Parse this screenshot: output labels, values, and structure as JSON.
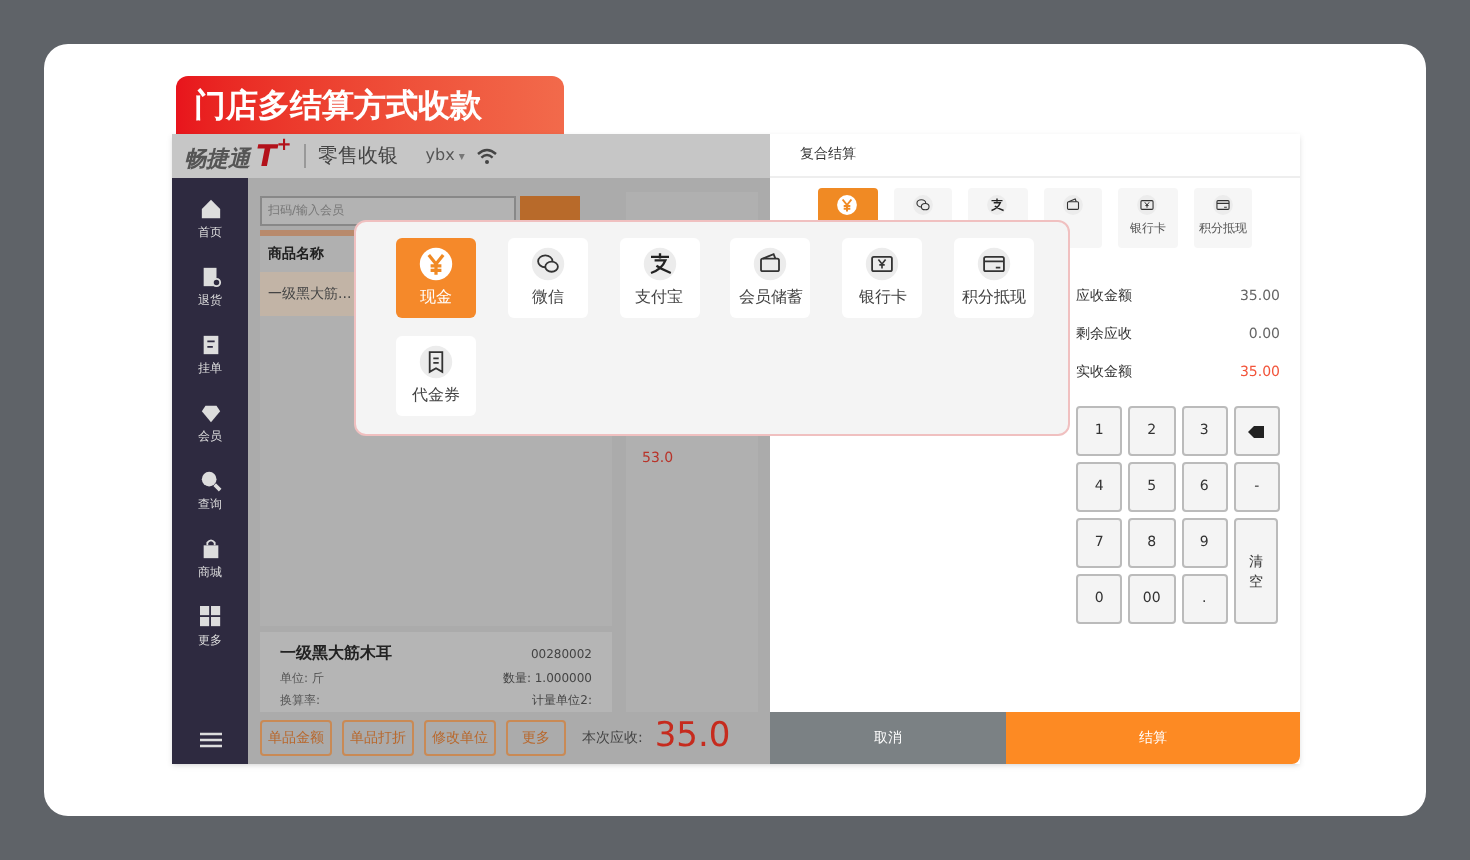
{
  "banner": {
    "title": "门店多结算方式收款"
  },
  "app": {
    "logo": "畅捷通",
    "logo_mark": "T",
    "logo_sup": "+",
    "module": "零售收银",
    "user": "ybx",
    "user_caret": "▾"
  },
  "sidebar": {
    "items": [
      {
        "label": "首页",
        "kind": "home"
      },
      {
        "label": "退货",
        "kind": "return"
      },
      {
        "label": "挂单",
        "kind": "hold"
      },
      {
        "label": "会员",
        "kind": "member"
      },
      {
        "label": "查询",
        "kind": "search"
      },
      {
        "label": "商城",
        "kind": "shop"
      },
      {
        "label": "更多",
        "kind": "more"
      }
    ]
  },
  "search": {
    "placeholder": "扫码/输入会员"
  },
  "table": {
    "columns": [
      "商品名称"
    ],
    "rows": [
      {
        "name": "一级黑大筋...",
        "selected": true
      }
    ],
    "side_value": "53.0"
  },
  "detail": {
    "name": "一级黑大筋木耳",
    "code": "00280002",
    "unit": "单位: 斤",
    "qty": "数量: 1.000000",
    "rate": "换算率:",
    "unit2": "计量单位2:"
  },
  "actions": [
    "单品金额",
    "单品打折",
    "修改单位",
    "更多"
  ],
  "due": {
    "label": "本次应收:",
    "value": "35.0"
  },
  "dialog": {
    "title": "复合结算",
    "small_methods": [
      {
        "kind": "cash",
        "selected": true
      },
      {
        "kind": "wechat",
        "selected": false
      },
      {
        "kind": "alipay",
        "selected": false
      },
      {
        "kind": "member",
        "selected": false
      },
      {
        "kind": "bank",
        "label": "银行卡",
        "selected": false
      },
      {
        "kind": "points",
        "label": "积分抵现",
        "selected": false
      }
    ],
    "summary": [
      {
        "label": "应收金额",
        "value": "35.00",
        "highlight": false
      },
      {
        "label": "剩余应收",
        "value": "0.00",
        "highlight": false
      },
      {
        "label": "实收金额",
        "value": "35.00",
        "highlight": true
      }
    ],
    "keys": [
      {
        "label": "1",
        "kind": "key"
      },
      {
        "label": "2",
        "kind": "key"
      },
      {
        "label": "3",
        "kind": "key"
      },
      {
        "kind": "backspace"
      },
      {
        "label": "4",
        "kind": "key"
      },
      {
        "label": "5",
        "kind": "key"
      },
      {
        "label": "6",
        "kind": "key"
      },
      {
        "label": "-",
        "kind": "key"
      },
      {
        "label": "7",
        "kind": "key"
      },
      {
        "label": "8",
        "kind": "key"
      },
      {
        "label": "9",
        "kind": "key"
      },
      {
        "label": "清空",
        "kind": "tall"
      },
      {
        "label": "0",
        "kind": "key"
      },
      {
        "label": "00",
        "kind": "key"
      },
      {
        "label": ".",
        "kind": "key"
      }
    ],
    "cancel": "取消",
    "confirm": "结算"
  },
  "popup": {
    "methods": [
      {
        "label": "现金",
        "kind": "cash",
        "selected": true
      },
      {
        "label": "微信",
        "kind": "wechat",
        "selected": false
      },
      {
        "label": "支付宝",
        "kind": "alipay",
        "selected": false
      },
      {
        "label": "会员储蓄",
        "kind": "member",
        "selected": false
      },
      {
        "label": "银行卡",
        "kind": "bank",
        "selected": false
      },
      {
        "label": "积分抵现",
        "kind": "points",
        "selected": false
      },
      {
        "label": "代金券",
        "kind": "voucher",
        "selected": false
      }
    ]
  }
}
